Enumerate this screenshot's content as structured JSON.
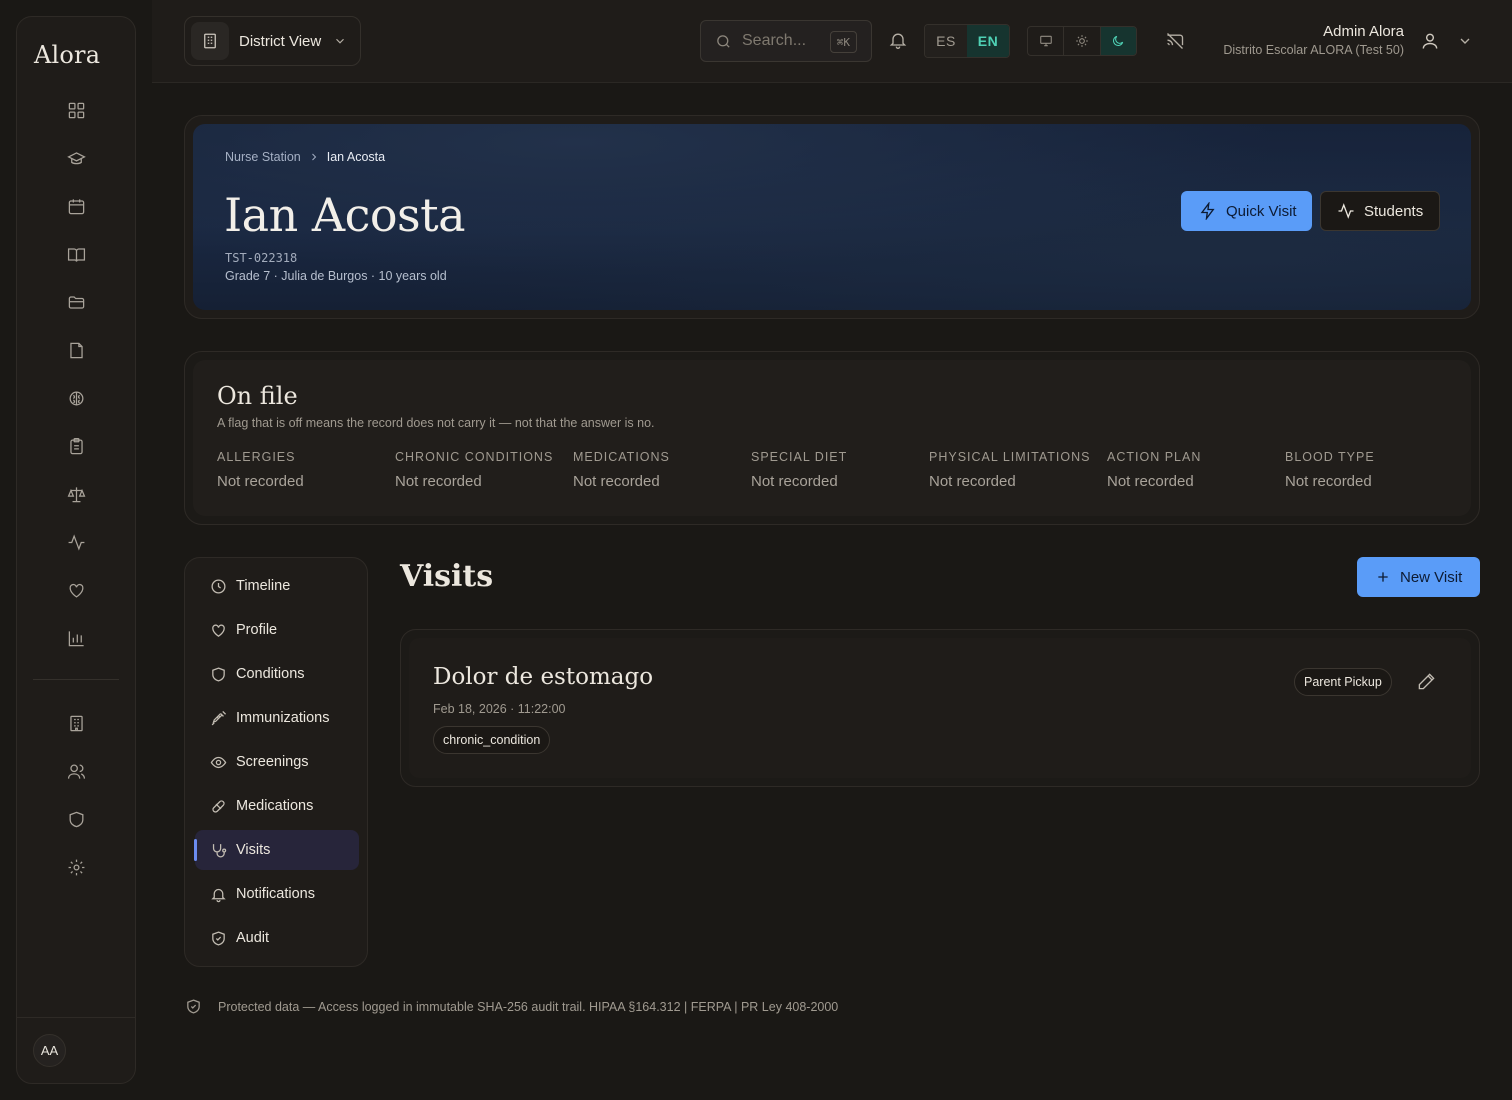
{
  "brand": "Alora",
  "header": {
    "district_label": "District View",
    "search_placeholder": "Search...",
    "search_shortcut": "⌘K",
    "lang": {
      "es": "ES",
      "en": "EN",
      "active": "EN"
    },
    "theme_active": "dark",
    "user_name": "Admin Alora",
    "user_org": "Distrito Escolar ALORA (Test 50)"
  },
  "sidebar": {
    "icons": [
      "dashboard-icon",
      "graduation-cap-icon",
      "calendar-icon",
      "book-icon",
      "folder-icon",
      "document-icon",
      "brain-icon",
      "clipboard-icon",
      "scale-icon",
      "activity-icon",
      "heart-icon",
      "bar-chart-icon",
      "building-icon",
      "users-icon",
      "shield-icon",
      "gear-icon"
    ],
    "avatar_initials": "AA"
  },
  "breadcrumb": {
    "parent": "Nurse Station",
    "current": "Ian Acosta"
  },
  "student": {
    "name": "Ian Acosta",
    "code": "TST-022318",
    "meta": "Grade 7 · Julia de Burgos · 10 years old"
  },
  "actions": {
    "quick_visit": "Quick Visit",
    "students": "Students"
  },
  "on_file": {
    "title": "On file",
    "subtitle": "A flag that is off means the record does not carry it — not that the answer is no.",
    "flags": [
      {
        "label": "ALLERGIES",
        "value": "Not recorded"
      },
      {
        "label": "CHRONIC CONDITIONS",
        "value": "Not recorded"
      },
      {
        "label": "MEDICATIONS",
        "value": "Not recorded"
      },
      {
        "label": "SPECIAL DIET",
        "value": "Not recorded"
      },
      {
        "label": "PHYSICAL LIMITATIONS",
        "value": "Not recorded"
      },
      {
        "label": "ACTION PLAN",
        "value": "Not recorded"
      },
      {
        "label": "BLOOD TYPE",
        "value": "Not recorded"
      }
    ]
  },
  "tabs": [
    {
      "label": "Timeline",
      "icon": "clock-icon"
    },
    {
      "label": "Profile",
      "icon": "heart-icon"
    },
    {
      "label": "Conditions",
      "icon": "shield-icon"
    },
    {
      "label": "Immunizations",
      "icon": "syringe-icon"
    },
    {
      "label": "Screenings",
      "icon": "eye-icon"
    },
    {
      "label": "Medications",
      "icon": "pill-icon"
    },
    {
      "label": "Visits",
      "icon": "stethoscope-icon",
      "active": true
    },
    {
      "label": "Notifications",
      "icon": "bell-icon"
    },
    {
      "label": "Audit",
      "icon": "shield-check-icon"
    }
  ],
  "visits": {
    "title": "Visits",
    "new_visit": "New Visit",
    "items": [
      {
        "title": "Dolor de estomago",
        "date": "Feb 18, 2026 · 11:22:00",
        "disposition": "Parent Pickup",
        "tag": "chronic_condition"
      }
    ]
  },
  "footer_note": "Protected data — Access logged in immutable SHA-256 audit trail. HIPAA §164.312 | FERPA | PR Ley 408-2000",
  "colors": {
    "accent_blue": "#5a9cf8",
    "accent_teal": "#4fd1b5",
    "background": "#1a1815"
  }
}
